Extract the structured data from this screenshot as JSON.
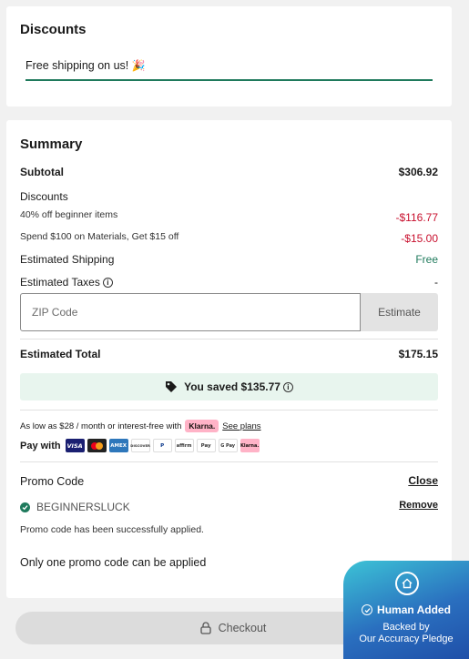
{
  "discounts": {
    "title": "Discounts",
    "shipping_message": "Free shipping on us!",
    "shipping_emoji": "🎉"
  },
  "summary": {
    "title": "Summary",
    "subtotal_label": "Subtotal",
    "subtotal_value": "$306.92",
    "discounts_label": "Discounts",
    "discount_items": [
      {
        "label": "40% off beginner items",
        "value": "-$116.77"
      },
      {
        "label": "Spend $100 on Materials, Get $15 off",
        "value": "-$15.00"
      }
    ],
    "shipping_label": "Estimated Shipping",
    "shipping_value": "Free",
    "taxes_label": "Estimated Taxes",
    "taxes_value": "-",
    "zip_placeholder": "ZIP Code",
    "estimate_label": "Estimate",
    "total_label": "Estimated Total",
    "total_value": "$175.15",
    "saved_text": "You saved $135.77",
    "klarna_text": "As low as $28 / month or interest-free with",
    "klarna_badge": "Klarna.",
    "see_plans": "See plans",
    "pay_with_label": "Pay with",
    "payment_methods": [
      {
        "name": "visa-icon",
        "text": "VISA"
      },
      {
        "name": "mastercard-icon",
        "text": ""
      },
      {
        "name": "amex-icon",
        "text": "AMEX"
      },
      {
        "name": "discover-icon",
        "text": "DISCOVER"
      },
      {
        "name": "paypal-icon",
        "text": "P"
      },
      {
        "name": "affirm-icon",
        "text": "affirm"
      },
      {
        "name": "apple-pay-icon",
        "text": "Pay"
      },
      {
        "name": "google-pay-icon",
        "text": "G Pay"
      },
      {
        "name": "klarna-icon",
        "text": "Klarna."
      }
    ]
  },
  "promo": {
    "label": "Promo Code",
    "close_label": "Close",
    "applied_code": "BEGINNERSLUCK",
    "remove_label": "Remove",
    "success_message": "Promo code has been successfully applied.",
    "note": "Only one promo code can be applied"
  },
  "checkout": {
    "label": "Checkout"
  },
  "pledge": {
    "title": "Human Added",
    "line1": "Backed by",
    "line2": "Our Accuracy Pledge"
  },
  "colors": {
    "accent_green": "#1f7a5c",
    "discount_red": "#c8102e",
    "saved_bg": "#e8f5ee",
    "klarna_pink": "#ffb3c7",
    "pledge_blue": "#2a6fbf"
  }
}
